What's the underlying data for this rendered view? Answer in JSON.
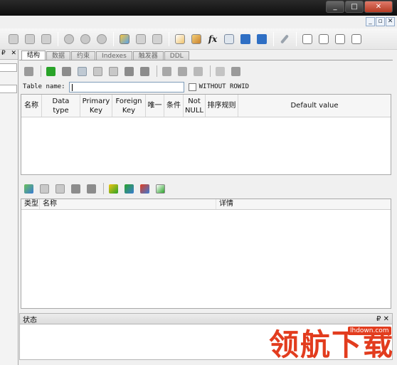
{
  "window": {
    "controls": {
      "minimize": "_",
      "maximize": "□",
      "close": "✕"
    },
    "mdi_controls": {
      "minimize": "_",
      "restore": "▫",
      "close": "✕"
    }
  },
  "main_toolbar": {
    "fx_label": "fx",
    "icons": [
      "edit-link-icon",
      "clear-link-icon",
      "unlink-icon",
      "gear-a-icon",
      "gear-b-icon",
      "gear-c-icon",
      "table-new-icon",
      "table-edit-icon",
      "table-delete-icon",
      "edit-sql-icon",
      "query-icon",
      "function-icon",
      "view-icon",
      "index-icon",
      "trigger-icon",
      "wrench-icon",
      "layout-grid-icon",
      "layout-cols-icon",
      "layout-rows-icon",
      "layout-float-icon"
    ]
  },
  "left_panel": {
    "pin": "₽",
    "close": "✕"
  },
  "tabs": [
    {
      "label": "结构",
      "active": true
    },
    {
      "label": "数据",
      "active": false
    },
    {
      "label": "约束",
      "active": false
    },
    {
      "label": "Indexes",
      "active": false
    },
    {
      "label": "触发器",
      "active": false
    },
    {
      "label": "DDL",
      "active": false
    }
  ],
  "structure": {
    "table_name_label": "Table name:",
    "table_name_value": "",
    "without_rowid_label": "WITHOUT ROWID",
    "without_rowid_checked": false,
    "columns_header": [
      "名称",
      "Data type",
      "Primary Key",
      "Foreign Key",
      "唯一",
      "条件",
      "Not NULL",
      "排序规则",
      "Default value"
    ],
    "constraints_header": [
      "类型",
      "名称",
      "详情"
    ]
  },
  "status_panel": {
    "title": "状态",
    "restore": "₽",
    "close": "✕"
  },
  "watermark": {
    "url": "lhdown.com",
    "logo": "领航下载"
  },
  "colors": {
    "accent_green": "#29a329",
    "accent_red": "#e23c1e",
    "accent_blue": "#3a7bd5"
  }
}
